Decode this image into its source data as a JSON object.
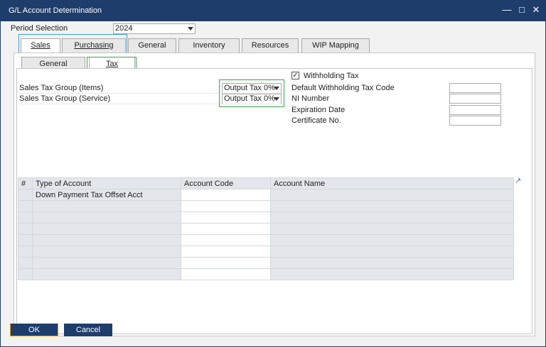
{
  "window": {
    "title": "G/L Account Determination"
  },
  "period": {
    "label": "Period Selection",
    "value": "2024"
  },
  "main_tabs": [
    {
      "label": "Sales"
    },
    {
      "label": "Purchasing"
    },
    {
      "label": "General"
    },
    {
      "label": "Inventory"
    },
    {
      "label": "Resources"
    },
    {
      "label": "WIP Mapping"
    }
  ],
  "sub_tabs": [
    {
      "label": "General"
    },
    {
      "label": "Tax"
    }
  ],
  "tax": {
    "items_label": "Sales Tax Group (Items)",
    "items_value": "Output Tax 0%",
    "service_label": "Sales Tax Group (Service)",
    "service_value": "Output Tax 0%"
  },
  "withholding": {
    "checkbox_label": "Withholding Tax",
    "checked": true,
    "fields": [
      {
        "label": "Default Withholding Tax Code"
      },
      {
        "label": "NI Number"
      },
      {
        "label": "Expiration Date"
      },
      {
        "label": "Certificate No."
      }
    ]
  },
  "table": {
    "columns": [
      "#",
      "Type of Account",
      "Account Code",
      "Account Name"
    ],
    "rows": [
      {
        "type": "Down Payment Tax Offset Acct",
        "code": "",
        "name": ""
      }
    ]
  },
  "buttons": {
    "ok": "OK",
    "cancel": "Cancel"
  }
}
